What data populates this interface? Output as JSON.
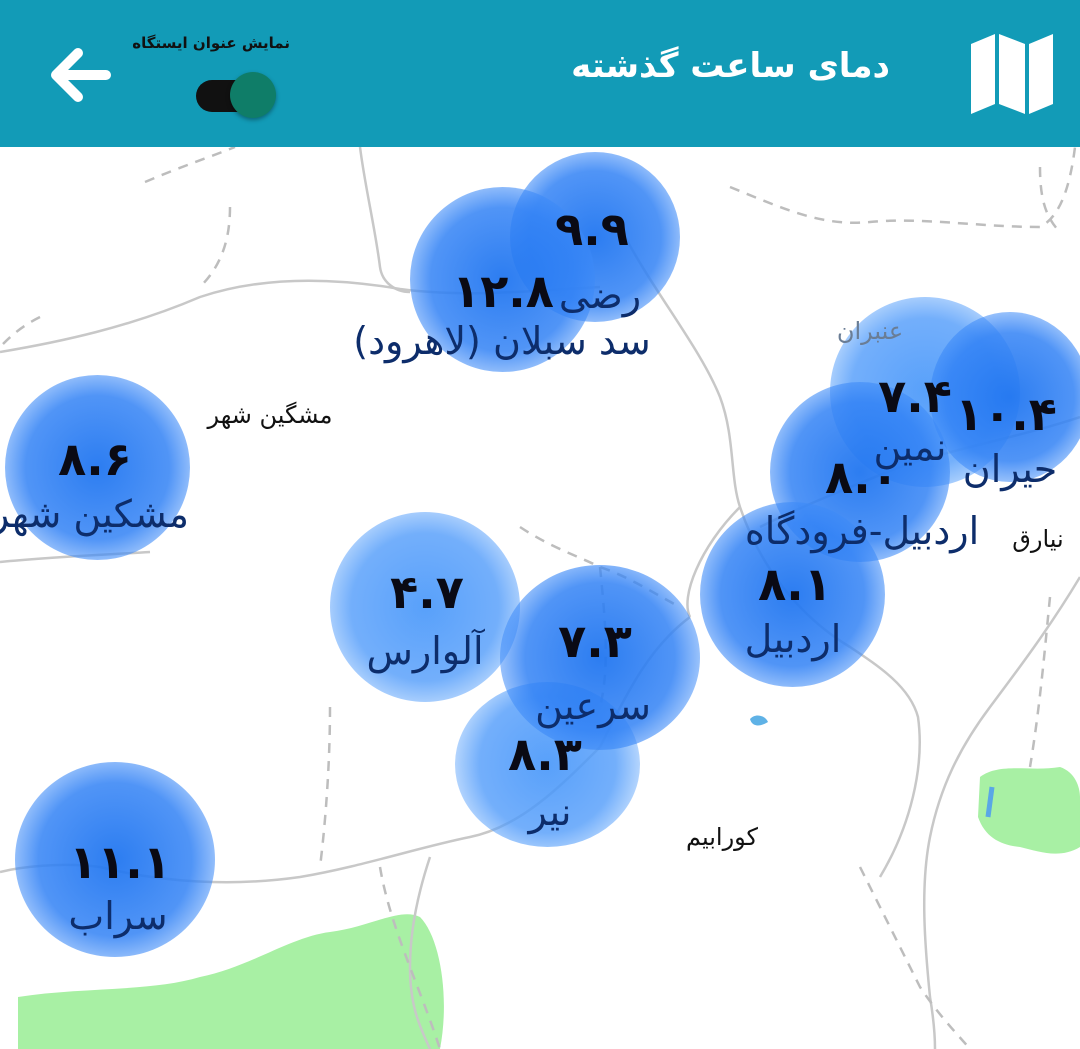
{
  "header": {
    "title": "دمای ساعت گذشته",
    "toggle_label": "نمایش عنوان ایستگاه",
    "toggle_on": true,
    "colors": {
      "bar": "#129bb7",
      "toggle_knob": "#0f7d68",
      "icon": "#ffffff"
    },
    "icons": {
      "map": "map-icon",
      "back": "arrow-left-icon"
    }
  },
  "stations": [
    {
      "name": "",
      "value": "۹.۹"
    },
    {
      "name": "رضی",
      "value": "۱۲.۸"
    },
    {
      "name": "سد سبلان (لاهرود)",
      "value": ""
    },
    {
      "name": "مشکین شهر",
      "value": "۸.۶"
    },
    {
      "name": "",
      "value": "۷.۴"
    },
    {
      "name": "",
      "value": "۱۰.۴"
    },
    {
      "name": "نمین",
      "value": ""
    },
    {
      "name": "حیران",
      "value": ""
    },
    {
      "name": "",
      "value": "۸.۰"
    },
    {
      "name": "اردبیل-فرودگاه",
      "value": ""
    },
    {
      "name": "اردبیل",
      "value": "۸.۱"
    },
    {
      "name": "آلوارس",
      "value": "۴.۷"
    },
    {
      "name": "سرعین",
      "value": "۷.۳"
    },
    {
      "name": "نیر",
      "value": "۸.۳"
    },
    {
      "name": "سراب",
      "value": "۱۱.۱"
    }
  ],
  "places": [
    {
      "name": "مشگین شهر"
    },
    {
      "name": "عنبران"
    },
    {
      "name": "نیارق"
    },
    {
      "name": "کورابیم"
    }
  ]
}
